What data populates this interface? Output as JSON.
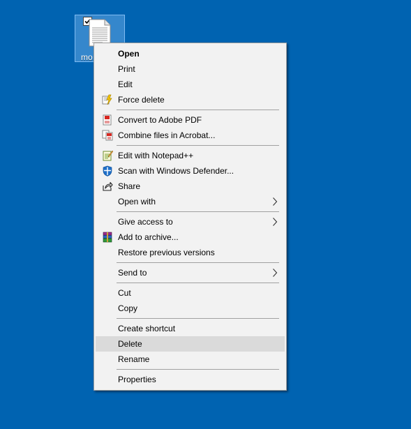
{
  "desktop": {
    "background_color": "#0063b1",
    "selected_file": {
      "label": "mo",
      "icon": "text-document-icon",
      "checked": true
    }
  },
  "context_menu": {
    "open": "Open",
    "print": "Print",
    "edit": "Edit",
    "force_delete": "Force delete",
    "convert_to_pdf": "Convert to Adobe PDF",
    "combine_acrobat": "Combine files in Acrobat...",
    "edit_notepad": "Edit with Notepad++",
    "scan_defender": "Scan with Windows Defender...",
    "share": "Share",
    "open_with": "Open with",
    "give_access": "Give access to",
    "add_archive": "Add to archive...",
    "restore_versions": "Restore previous versions",
    "send_to": "Send to",
    "cut": "Cut",
    "copy": "Copy",
    "create_shortcut": "Create shortcut",
    "delete": "Delete",
    "rename": "Rename",
    "properties": "Properties",
    "highlighted_item": "Delete"
  }
}
